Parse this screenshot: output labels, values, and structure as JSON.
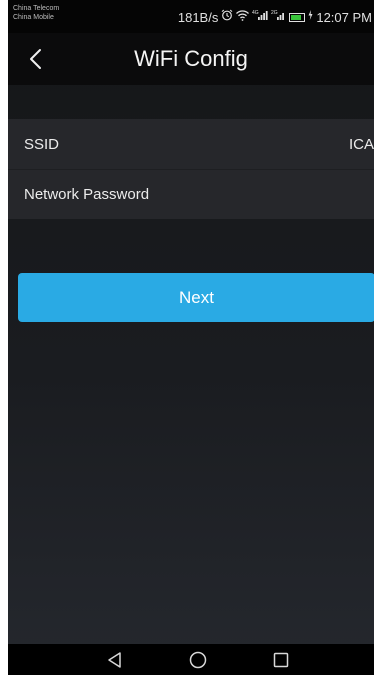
{
  "status_bar": {
    "carrier_1": "China Telecom",
    "carrier_2": "China Mobile",
    "speed": "181B/s",
    "signal_1_label": "4G",
    "signal_2_label": "2G",
    "time": "12:07 PM",
    "battery_color": "#39c43b"
  },
  "title_bar": {
    "title": "WiFi Config",
    "back_icon": "chevron-left-icon"
  },
  "form": {
    "ssid_label": "SSID",
    "ssid_value": "ICA",
    "password_label": "Network Password",
    "password_value": "",
    "password_placeholder": ""
  },
  "actions": {
    "next_label": "Next",
    "accent_color": "#2aaae4"
  },
  "nav_bar": {
    "back_icon": "triangle-back-icon",
    "home_icon": "circle-home-icon",
    "recents_icon": "square-recents-icon"
  }
}
